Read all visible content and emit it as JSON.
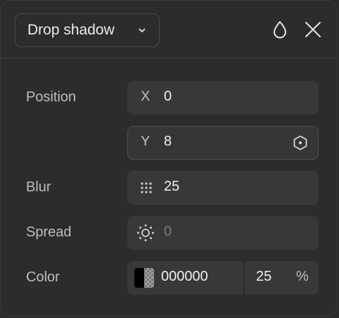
{
  "header": {
    "effect_type": "Drop shadow",
    "icons": [
      "chevron-down-icon",
      "droplet-icon",
      "close-icon"
    ]
  },
  "rows": {
    "position": {
      "label": "Position",
      "x_axis": "X",
      "x_value": "0",
      "y_axis": "Y",
      "y_value": "8"
    },
    "blur": {
      "label": "Blur",
      "value": "25",
      "icon": "blur-dots-icon"
    },
    "spread": {
      "label": "Spread",
      "value": "0",
      "icon": "sun-icon"
    },
    "color": {
      "label": "Color",
      "hex": "000000",
      "opacity": "25",
      "unit": "%"
    }
  },
  "colors": {
    "panel_bg": "#2c2c2c",
    "field_bg": "#383838",
    "text": "#f0f0f0",
    "label": "#bdbdbd",
    "muted": "#7a7a7a",
    "swatch": "#000000"
  }
}
